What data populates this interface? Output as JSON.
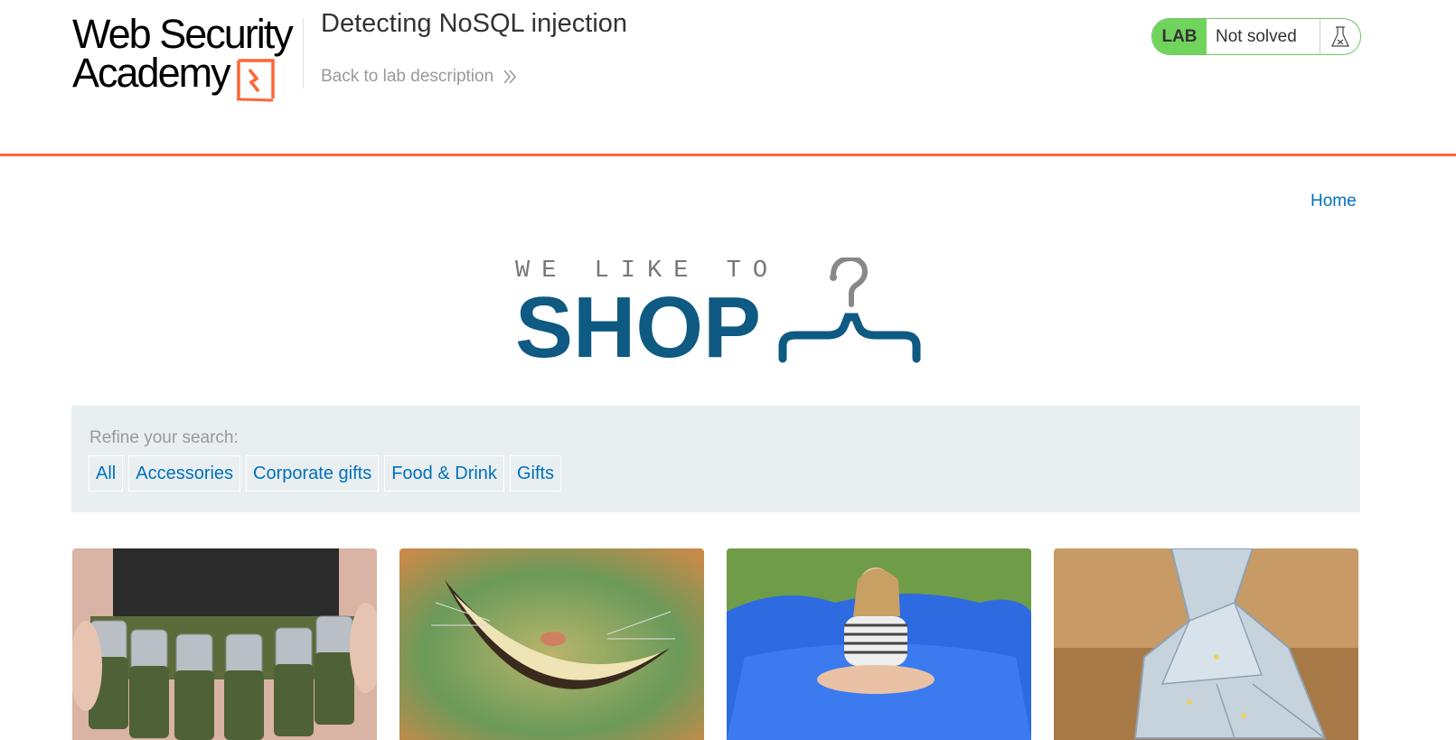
{
  "header": {
    "logo_line1": "Web Security",
    "logo_line2": "Academy",
    "lab_title": "Detecting NoSQL injection",
    "back_link": "Back to lab description",
    "badge_label": "LAB",
    "badge_status": "Not solved"
  },
  "nav": {
    "home": "Home"
  },
  "shop": {
    "tagline": "WE LIKE TO",
    "word": "SHOP"
  },
  "filter": {
    "label": "Refine your search:",
    "categories": [
      "All",
      "Accessories",
      "Corporate gifts",
      "Food & Drink",
      "Gifts"
    ]
  },
  "colors": {
    "accent": "#ff6633",
    "link": "#0071bc",
    "brand_blue": "#0e5a82",
    "lab_green": "#70d45c"
  },
  "products": [
    {
      "image": "beer-belt-image"
    },
    {
      "image": "cheshire-smile-image"
    },
    {
      "image": "blue-beanbag-image"
    },
    {
      "image": "origami-money-image"
    }
  ]
}
